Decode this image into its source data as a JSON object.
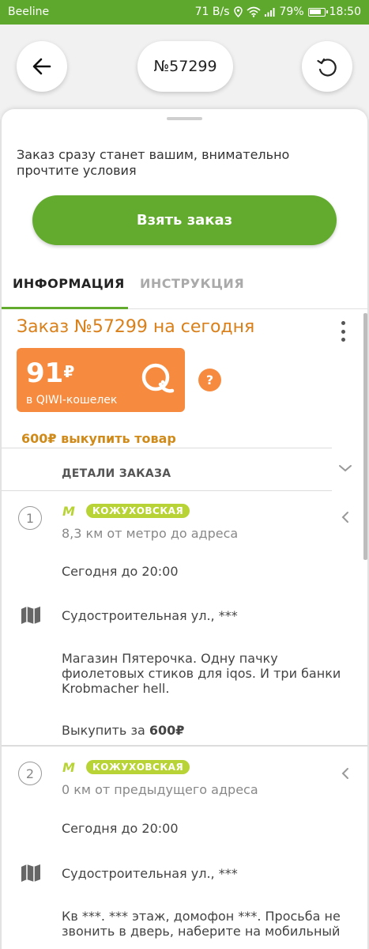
{
  "status_bar": {
    "carrier": "Beeline",
    "speed": "71 B/s",
    "battery": "79%",
    "time": "18:50"
  },
  "header": {
    "order_number": "№57299",
    "back_icon": "arrow-left-icon",
    "refresh_icon": "refresh-icon"
  },
  "sheet": {
    "notice": "Заказ сразу станет вашим, внимательно прочтите условия",
    "take_button": "Взять заказ",
    "tabs": [
      {
        "label": "ИНФОРМАЦИЯ",
        "active": true
      },
      {
        "label": "ИНСТРУКЦИЯ",
        "active": false
      }
    ]
  },
  "order": {
    "title": "Заказ №57299 на сегодня",
    "payment_amount": "91",
    "currency": "₽",
    "payment_method": "в QIWI-кошелек",
    "help": "?",
    "buy_text": "600₽ выкупить товар",
    "details_header": "ДЕТАЛИ ЗАКАЗА"
  },
  "points": [
    {
      "number": "1",
      "metro_letter": "М",
      "metro_station": "КОЖУХОВСКАЯ",
      "distance": "8,3 км от метро до адреса",
      "time": "Сегодня до 20:00",
      "address": "Судостроительная ул., ***",
      "description": "Магазин Пятерочка. Одну пачку фиолетовых стиков для iqos. И три банки Krobmacher hell.",
      "buy_prefix": "Выкупить за ",
      "buy_amount": "600₽"
    },
    {
      "number": "2",
      "metro_letter": "М",
      "metro_station": "КОЖУХОВСКАЯ",
      "distance": "0 км от предыдущего адреса",
      "time": "Сегодня до 20:00",
      "address": "Судостроительная ул., ***",
      "description": "Кв ***. *** этаж, домофон ***. Просьба не звонить в дверь, наберите на мобильный"
    }
  ],
  "colors": {
    "brand_green": "#62ab2e",
    "accent_orange": "#f68b3f",
    "title_orange": "#d9801b",
    "metro_green": "#b8d336"
  }
}
